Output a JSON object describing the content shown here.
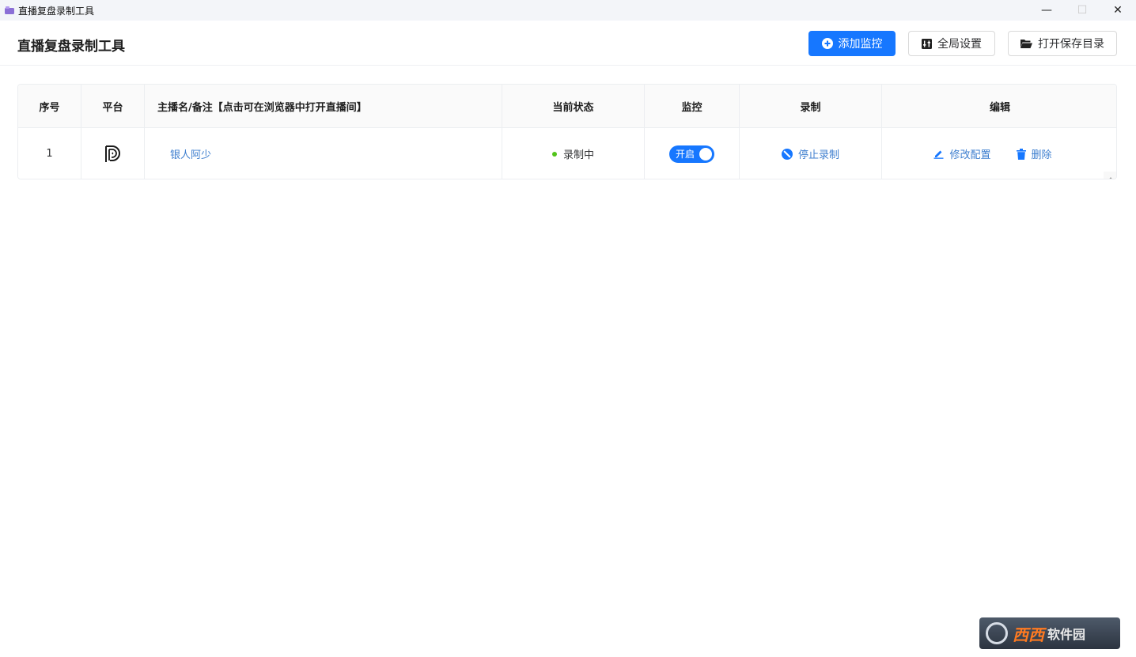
{
  "window": {
    "title": "直播复盘录制工具",
    "minimize": "—",
    "maximize": "☐",
    "close": "✕"
  },
  "header": {
    "title": "直播复盘录制工具",
    "add_monitor_label": "添加监控",
    "global_settings_label": "全局设置",
    "open_save_dir_label": "打开保存目录"
  },
  "table": {
    "columns": {
      "index": "序号",
      "platform": "平台",
      "name": "主播名/备注【点击可在浏览器中打开直播间】",
      "state": "当前状态",
      "monitor": "监控",
      "record": "录制",
      "edit": "编辑"
    },
    "rows": [
      {
        "index": "1",
        "platform_icon": "douyin-d-logo",
        "name": "银人阿少",
        "state": "录制中",
        "monitor_switch_label": "开启",
        "monitor_on": true,
        "record_action": "停止录制",
        "edit_action": "修改配置",
        "delete_action": "删除"
      }
    ]
  },
  "colors": {
    "primary": "#1677ff",
    "link": "#3f7fcf",
    "status_green": "#52c41a"
  },
  "watermark": {
    "text": "西西",
    "sub": "软件园"
  }
}
